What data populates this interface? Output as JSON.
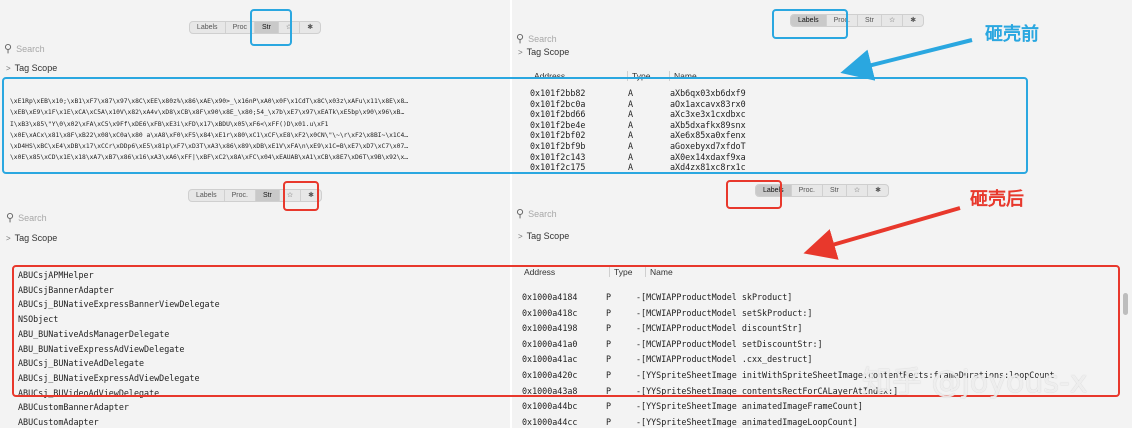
{
  "segments": [
    "Labels",
    "Proc.",
    "Str",
    "☆",
    "✱"
  ],
  "segments_tl": [
    "Labels",
    "Proc",
    "Str",
    "☆",
    "✱"
  ],
  "search_placeholder": "Search",
  "tag_scope": "Tag Scope",
  "top_left_strings": [
    "\\xE1Rp\\xEB\\x10;\\xB1\\xF7\\x87\\x97\\x8C\\xEE\\x80z%\\x86\\xAE\\x90>_\\x16nP\\xA0\\x0F\\x1CdT\\x8C\\x03z\\xAFu\\x11\\x8E\\x8…",
    "\\xEB\\xE9\\x1F\\x1E\\xCA\\xC5A\\x10V\\x82\\xA4v\\xD8\\xCB\\x8F\\x90\\x8E_\\x80;54_\\x7b\\xE7\\x97\\xEATk\\xE5bp\\x90\\x96\\xB…",
    "I\\xB3\\x85\\\"Y\\0\\x02\\xFA\\xC5\\x9Ff\\xDE6\\xFB\\xE3i\\xFD\\x17\\xBDU\\x05\\xF6<\\xFF()D\\x01.u\\xF1",
    "\\x0E\\xACx\\x81\\x8F\\xB22\\x08\\xC0a\\x80 a\\xA8\\xF0\\xF5\\x84\\xE1r\\x80\\xC1\\xCF\\xE8\\xF2\\x0CN\\\"\\~\\r\\xF2\\x8BI~\\x1C4…",
    "\\xD4HS\\xBC\\xE4\\xDB\\x17\\xCCr\\xDDp6\\xE5\\x81p\\xF7\\xD3T\\xA3\\x86\\x89\\xDB\\xE1V\\xFA\\n\\xE9\\x1C=B\\xE7\\xD7\\xC7\\x07…",
    "\\x0E\\x85\\xCD\\x1E\\x18\\xA7\\xB7\\x86\\x16\\xA3\\xA6\\xFF|\\xBF\\xC2\\x8A\\xFC\\x04\\xEAUAB\\xA1\\xCB\\x8E7\\xD6T\\x9B\\x92\\x…"
  ],
  "top_right": {
    "columns": [
      "Address",
      "Type",
      "Name"
    ],
    "rows": [
      {
        "address": "0x101f2bb82",
        "type": "A",
        "name": "aXb6qx03xb6dxf9"
      },
      {
        "address": "0x101f2bc0a",
        "type": "A",
        "name": "aOx1axcavx83rx0"
      },
      {
        "address": "0x101f2bd66",
        "type": "A",
        "name": "aXc3xe3x1cxdbxc"
      },
      {
        "address": "0x101f2be4e",
        "type": "A",
        "name": "aXb5dxafkx89snx"
      },
      {
        "address": "0x101f2bf02",
        "type": "A",
        "name": "aXe6x85xa0xfenx"
      },
      {
        "address": "0x101f2bf9b",
        "type": "A",
        "name": "aGoxebyxd7xfdoT"
      },
      {
        "address": "0x101f2c143",
        "type": "A",
        "name": "aX0ex14xdaxf9xa"
      },
      {
        "address": "0x101f2c175",
        "type": "A",
        "name": "aXd4zx81xc8rx1c"
      }
    ]
  },
  "bottom_left_names": [
    "ABUCsjAPMHelper",
    "ABUCsjBannerAdapter",
    "ABUCsj_BUNativeExpressBannerViewDelegate",
    "NSObject",
    "ABU_BUNativeAdsManagerDelegate",
    "ABU_BUNativeExpressAdViewDelegate",
    "ABUCsj_BUNativeAdDelegate",
    "ABUCsj_BUNativeExpressAdViewDelegate",
    "ABUCsj_BUVideoAdViewDelegate",
    "ABUCustomBannerAdapter",
    "ABUCustomAdapter"
  ],
  "bottom_right": {
    "columns": [
      "Address",
      "Type",
      "Name"
    ],
    "rows": [
      {
        "address": "0x1000a4184",
        "type": "P",
        "name": "-[MCWIAPProductModel skProduct]"
      },
      {
        "address": "0x1000a418c",
        "type": "P",
        "name": "-[MCWIAPProductModel setSkProduct:]"
      },
      {
        "address": "0x1000a4198",
        "type": "P",
        "name": "-[MCWIAPProductModel discountStr]"
      },
      {
        "address": "0x1000a41a0",
        "type": "P",
        "name": "-[MCWIAPProductModel setDiscountStr:]"
      },
      {
        "address": "0x1000a41ac",
        "type": "P",
        "name": "-[MCWIAPProductModel .cxx_destruct]"
      },
      {
        "address": "0x1000a420c",
        "type": "P",
        "name": "-[YYSpriteSheetImage initWithSpriteSheetImage:contentRects:frameDurations:loopCount"
      },
      {
        "address": "0x1000a43a8",
        "type": "P",
        "name": "-[YYSpriteSheetImage contentsRectForCALayerAtIndex:]"
      },
      {
        "address": "0x1000a44bc",
        "type": "P",
        "name": "-[YYSpriteSheetImage animatedImageFrameCount]"
      },
      {
        "address": "0x1000a44cc",
        "type": "P",
        "name": "-[YYSpriteSheetImage animatedImageLoopCount]"
      }
    ]
  },
  "label_before": "砸壳前",
  "label_after": "砸壳后",
  "watermark": "知乎 @joyous-x",
  "colors": {
    "blue": "#2aa7e0",
    "red": "#e8382c"
  }
}
